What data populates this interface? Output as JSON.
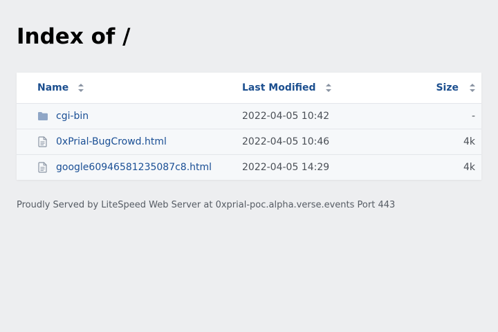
{
  "page": {
    "title": "Index of /"
  },
  "table": {
    "headers": {
      "name": "Name",
      "last_modified": "Last Modified",
      "size": "Size"
    },
    "rows": [
      {
        "name": "cgi-bin",
        "type": "folder",
        "icon": "folder-icon",
        "modified": "2022-04-05 10:42",
        "size": "-"
      },
      {
        "name": "0xPrial-BugCrowd.html",
        "type": "file",
        "icon": "file-icon",
        "modified": "2022-04-05 10:46",
        "size": "4k"
      },
      {
        "name": "google60946581235087c8.html",
        "type": "file",
        "icon": "file-icon",
        "modified": "2022-04-05 14:29",
        "size": "4k"
      }
    ]
  },
  "footer": {
    "text": "Proudly Served by LiteSpeed Web Server at 0xprial-poc.alpha.verse.events Port 443"
  },
  "colors": {
    "background": "#edeef0",
    "link": "#1a4f95",
    "header_link": "#1c4f8f",
    "row_background": "#f6f8fa",
    "folder_icon": "#8fa6c6",
    "file_icon": "#8a94a3"
  }
}
